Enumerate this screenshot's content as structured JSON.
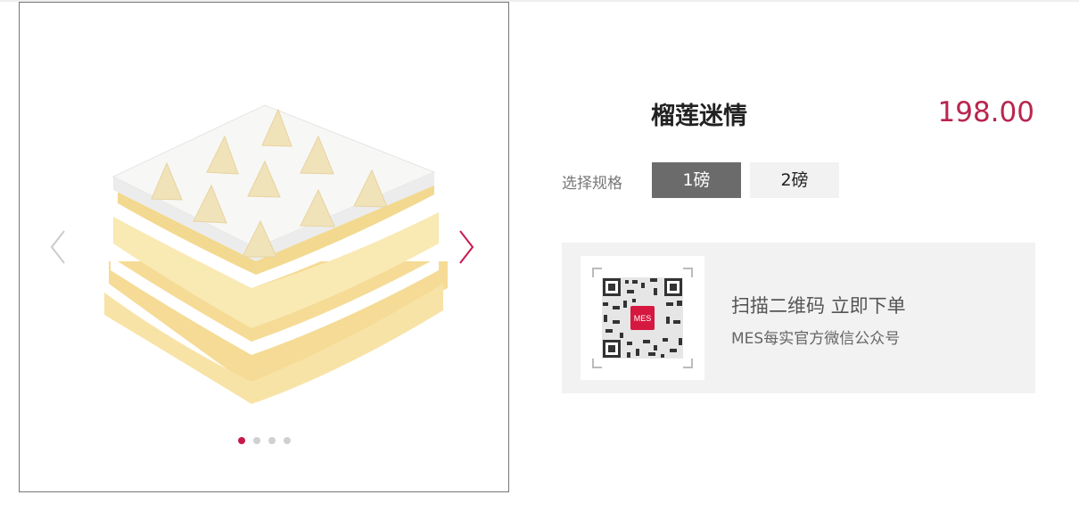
{
  "product": {
    "title": "榴莲迷情",
    "price": "198.00"
  },
  "spec": {
    "label": "选择规格",
    "options": [
      "1磅",
      "2磅"
    ],
    "selected": "1磅"
  },
  "qr": {
    "line1": "扫描二维码 立即下单",
    "line2": "MES每实官方微信公众号",
    "logo_text": "MES"
  },
  "gallery": {
    "slides": 4,
    "active_slide": 1,
    "prev_icon": "chevron-left-icon",
    "next_icon": "chevron-right-icon"
  },
  "colors": {
    "accent": "#c8194d",
    "price": "#b8264f",
    "selected_bg": "#6b6b6b",
    "panel_bg": "#f2f2f2"
  }
}
